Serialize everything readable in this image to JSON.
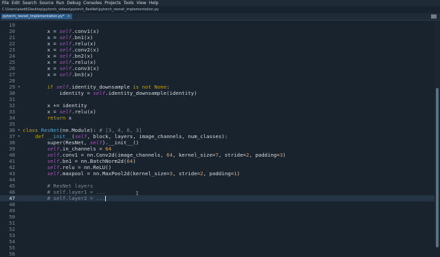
{
  "menubar": {
    "items": [
      "File",
      "Edit",
      "Search",
      "Source",
      "Run",
      "Debug",
      "Consoles",
      "Projects",
      "Tools",
      "View",
      "Help"
    ]
  },
  "path": "C:\\Users\\aladd\\Desktop\\pytorch_videos\\pytorch_ResNet\\pytorch_resnet_implementation.py",
  "tab": {
    "label": "pytorch_resnet_implementation.py*",
    "close": "×"
  },
  "editor": {
    "current_line": 47,
    "lines": [
      {
        "n": "19",
        "tokens": []
      },
      {
        "n": "20",
        "tokens": [
          [
            "plain",
            "        x = "
          ],
          [
            "self",
            "self"
          ],
          [
            "plain",
            ".conv1(x)"
          ]
        ]
      },
      {
        "n": "21",
        "tokens": [
          [
            "plain",
            "        x = "
          ],
          [
            "self",
            "self"
          ],
          [
            "plain",
            ".bn1(x)"
          ]
        ]
      },
      {
        "n": "22",
        "tokens": [
          [
            "plain",
            "        x = "
          ],
          [
            "self",
            "self"
          ],
          [
            "plain",
            ".relu(x)"
          ]
        ]
      },
      {
        "n": "23",
        "tokens": [
          [
            "plain",
            "        x = "
          ],
          [
            "self",
            "self"
          ],
          [
            "plain",
            ".conv2(x)"
          ]
        ]
      },
      {
        "n": "24",
        "tokens": [
          [
            "plain",
            "        x = "
          ],
          [
            "self",
            "self"
          ],
          [
            "plain",
            ".bn2(x)"
          ]
        ]
      },
      {
        "n": "25",
        "tokens": [
          [
            "plain",
            "        x = "
          ],
          [
            "self",
            "self"
          ],
          [
            "plain",
            ".relu(x)"
          ]
        ]
      },
      {
        "n": "26",
        "tokens": [
          [
            "plain",
            "        x = "
          ],
          [
            "self",
            "self"
          ],
          [
            "plain",
            ".conv3(x)"
          ]
        ]
      },
      {
        "n": "27",
        "tokens": [
          [
            "plain",
            "        x = "
          ],
          [
            "self",
            "self"
          ],
          [
            "plain",
            ".bn3(x)"
          ]
        ]
      },
      {
        "n": "28",
        "tokens": []
      },
      {
        "n": "29",
        "fold": "▾",
        "tokens": [
          [
            "plain",
            "        "
          ],
          [
            "kw",
            "if "
          ],
          [
            "self",
            "self"
          ],
          [
            "plain",
            ".identity_downsample "
          ],
          [
            "kw",
            "is not None"
          ],
          [
            "plain",
            ":"
          ]
        ]
      },
      {
        "n": "30",
        "tokens": [
          [
            "plain",
            "            identity = "
          ],
          [
            "self",
            "self"
          ],
          [
            "plain",
            ".identity_downsample(identity)"
          ]
        ]
      },
      {
        "n": "31",
        "tokens": []
      },
      {
        "n": "32",
        "tokens": [
          [
            "plain",
            "        x += identity"
          ]
        ]
      },
      {
        "n": "33",
        "tokens": [
          [
            "plain",
            "        x = "
          ],
          [
            "self",
            "self"
          ],
          [
            "plain",
            ".relu(x)"
          ]
        ]
      },
      {
        "n": "34",
        "tokens": [
          [
            "plain",
            "        "
          ],
          [
            "kw",
            "return "
          ],
          [
            "plain",
            "x"
          ]
        ]
      },
      {
        "n": "35",
        "tokens": []
      },
      {
        "n": "36",
        "fold": "▾",
        "tokens": [
          [
            "kw",
            "class "
          ],
          [
            "def",
            "ResNet"
          ],
          [
            "plain",
            "(nn.Module): "
          ],
          [
            "cmt",
            "# [3, 4, 6, 3]"
          ]
        ]
      },
      {
        "n": "37",
        "fold": "▾",
        "tokens": [
          [
            "plain",
            "    "
          ],
          [
            "kw",
            "def "
          ],
          [
            "def",
            "__init__"
          ],
          [
            "plain",
            "("
          ],
          [
            "self",
            "self"
          ],
          [
            "plain",
            ", block, layers, image_channels, num_classes):"
          ]
        ]
      },
      {
        "n": "38",
        "tokens": [
          [
            "plain",
            "        super(ResNet, "
          ],
          [
            "self",
            "self"
          ],
          [
            "plain",
            ").__init__()"
          ]
        ]
      },
      {
        "n": "39",
        "tokens": [
          [
            "plain",
            "        "
          ],
          [
            "self",
            "self"
          ],
          [
            "plain",
            ".in_channels = "
          ],
          [
            "num",
            "64"
          ]
        ]
      },
      {
        "n": "40",
        "tokens": [
          [
            "plain",
            "        "
          ],
          [
            "self",
            "self"
          ],
          [
            "plain",
            ".conv1 = nn.Conv2d(image_channels, "
          ],
          [
            "num",
            "64"
          ],
          [
            "plain",
            ", kernel_size="
          ],
          [
            "num",
            "7"
          ],
          [
            "plain",
            ", stride="
          ],
          [
            "num",
            "2"
          ],
          [
            "plain",
            ", padding="
          ],
          [
            "num",
            "3"
          ],
          [
            "plain",
            ")"
          ]
        ]
      },
      {
        "n": "41",
        "tokens": [
          [
            "plain",
            "        "
          ],
          [
            "self",
            "self"
          ],
          [
            "plain",
            ".bn1 = nn.BatchNorm2d("
          ],
          [
            "num",
            "64"
          ],
          [
            "plain",
            ")"
          ]
        ]
      },
      {
        "n": "42",
        "tokens": [
          [
            "plain",
            "        "
          ],
          [
            "self",
            "self"
          ],
          [
            "plain",
            ".relu = nn.ReLU()"
          ]
        ]
      },
      {
        "n": "43",
        "tokens": [
          [
            "plain",
            "        "
          ],
          [
            "self",
            "self"
          ],
          [
            "plain",
            ".maxpool = nn.MaxPool2d(kernel_size="
          ],
          [
            "num",
            "3"
          ],
          [
            "plain",
            ", stride="
          ],
          [
            "num",
            "2"
          ],
          [
            "plain",
            ", padding="
          ],
          [
            "num",
            "1"
          ],
          [
            "plain",
            ")"
          ]
        ]
      },
      {
        "n": "44",
        "tokens": []
      },
      {
        "n": "45",
        "tokens": [
          [
            "plain",
            "        "
          ],
          [
            "cmt",
            "# ResNet layers"
          ]
        ]
      },
      {
        "n": "46",
        "tokens": [
          [
            "plain",
            "        "
          ],
          [
            "cmt",
            "# self.layer1 = ..."
          ]
        ]
      },
      {
        "n": "47",
        "tokens": [
          [
            "plain",
            "        "
          ],
          [
            "cmt",
            "# self.layer2 = ..."
          ]
        ],
        "cursor": true
      },
      {
        "n": "48",
        "tokens": []
      },
      {
        "n": "49",
        "tokens": []
      },
      {
        "n": "50",
        "tokens": []
      },
      {
        "n": "51",
        "tokens": []
      },
      {
        "n": "52",
        "tokens": []
      },
      {
        "n": "53",
        "tokens": []
      },
      {
        "n": "54",
        "tokens": []
      },
      {
        "n": "55",
        "tokens": []
      },
      {
        "n": "56",
        "tokens": []
      }
    ]
  },
  "colors": {
    "background": "#19232d",
    "keyword": "#c8a000",
    "self": "#b04ec5",
    "number": "#e0a060",
    "comment": "#808a94",
    "definition": "#4ea6d6",
    "tab_active": "#2c5b8a"
  }
}
